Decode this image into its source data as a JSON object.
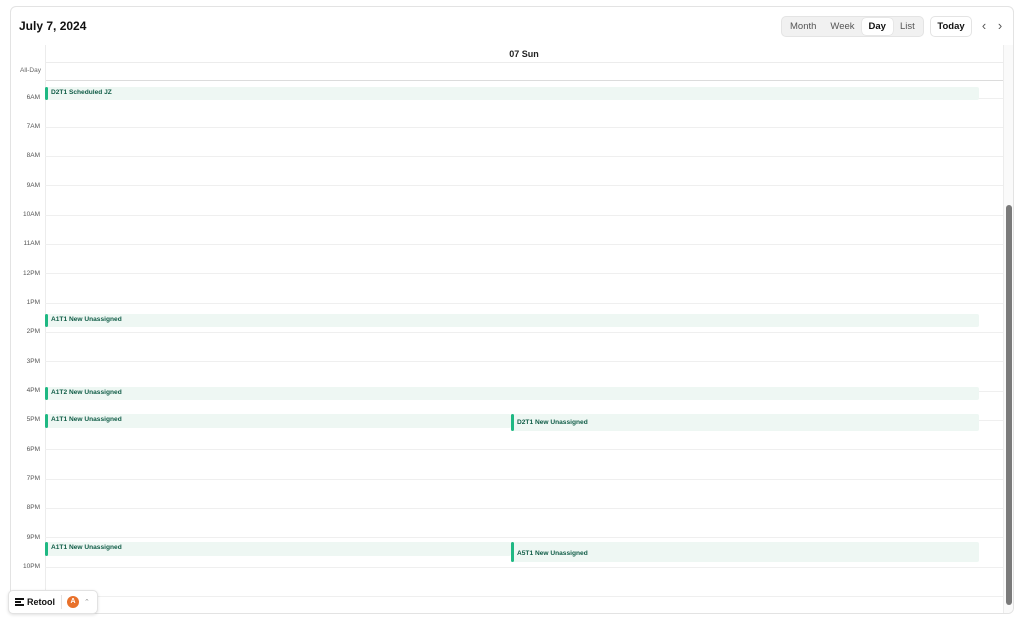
{
  "header": {
    "date_title": "July 7, 2024",
    "today_label": "Today",
    "prev_icon": "‹",
    "next_icon": "›"
  },
  "views": [
    {
      "label": "Month",
      "active": false
    },
    {
      "label": "Week",
      "active": false
    },
    {
      "label": "Day",
      "active": true
    },
    {
      "label": "List",
      "active": false
    }
  ],
  "day_column": {
    "label": "07 Sun"
  },
  "allday_label": "All-Day",
  "hours": [
    "6AM",
    "7AM",
    "8AM",
    "9AM",
    "10AM",
    "11AM",
    "12PM",
    "1PM",
    "2PM",
    "3PM",
    "4PM",
    "5PM",
    "6PM",
    "7PM",
    "8PM",
    "9PM",
    "10PM"
  ],
  "events": [
    {
      "label": "D2T1 Scheduled JZ"
    },
    {
      "label": "A1T1 New Unassigned"
    },
    {
      "label": "A1T2 New Unassigned"
    },
    {
      "label": "A1T1 New Unassigned"
    },
    {
      "label": "D2T1 New Unassigned"
    },
    {
      "label": "A1T1 New Unassigned"
    },
    {
      "label": "A5T1 New Unassigned"
    }
  ],
  "retool": {
    "label": "Retool",
    "avatar_initial": "A",
    "chevron": "⌃"
  },
  "colors": {
    "event_accent": "#1fb883",
    "event_bg": "#eef7f3",
    "event_text": "#0f5c46",
    "avatar": "#e8712b"
  }
}
